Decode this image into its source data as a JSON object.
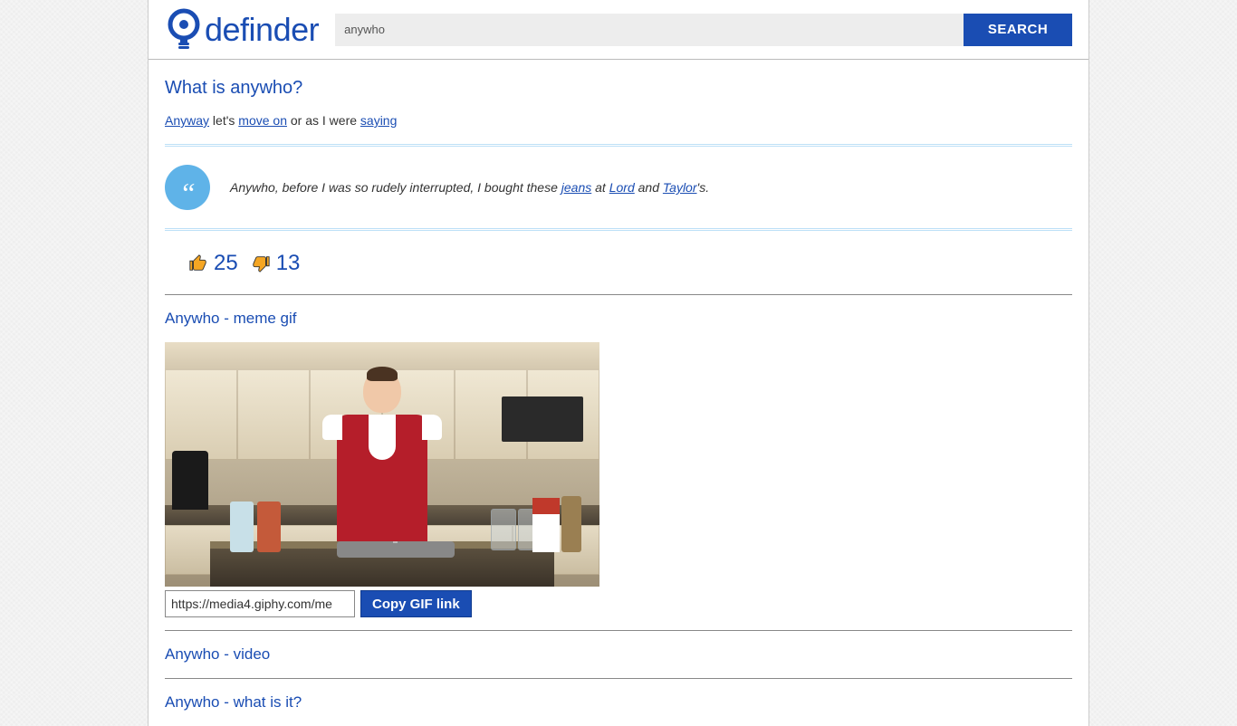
{
  "header": {
    "logo_text": "definder",
    "search_value": "anywho",
    "search_button": "SEARCH"
  },
  "main": {
    "title": "What is anywho?",
    "definition": {
      "link_anyway": "Anyway",
      "text_1": " let's ",
      "link_move_on": "move on",
      "text_2": " or as I were ",
      "link_saying": "saying"
    },
    "quote": {
      "text_before": "Anywho, before I was so rudely interrupted, I bought these ",
      "link_jeans": "jeans",
      "text_at": " at ",
      "link_lord": "Lord",
      "text_and": " and ",
      "link_taylor": "Taylor",
      "text_end": "'s."
    },
    "votes": {
      "up": "25",
      "down": "13"
    }
  },
  "sections": {
    "meme_heading": "Anywho - meme gif",
    "gif_url": "https://media4.giphy.com/me",
    "copy_button": "Copy GIF link",
    "video_heading": "Anywho - video",
    "whatis_heading": "Anywho - what is it?"
  }
}
